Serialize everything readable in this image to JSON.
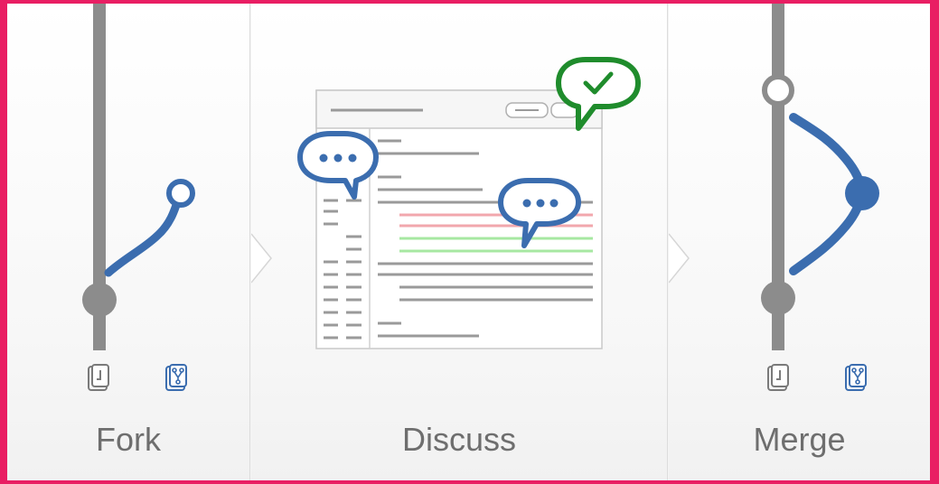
{
  "steps": [
    {
      "label": "Fork"
    },
    {
      "label": "Discuss"
    },
    {
      "label": "Merge"
    }
  ],
  "colors": {
    "blue": "#3b6daf",
    "gray": "#8c8c8c",
    "green": "#1f8c2c",
    "red_line": "#f2a7ad",
    "green_line": "#a7e8a2",
    "border": "#e91e63"
  },
  "icons": [
    "repo-icon",
    "fork-repo-icon",
    "comment-bubble-icon",
    "approved-bubble-icon",
    "checkmark-icon",
    "chevron-separator-icon"
  ]
}
